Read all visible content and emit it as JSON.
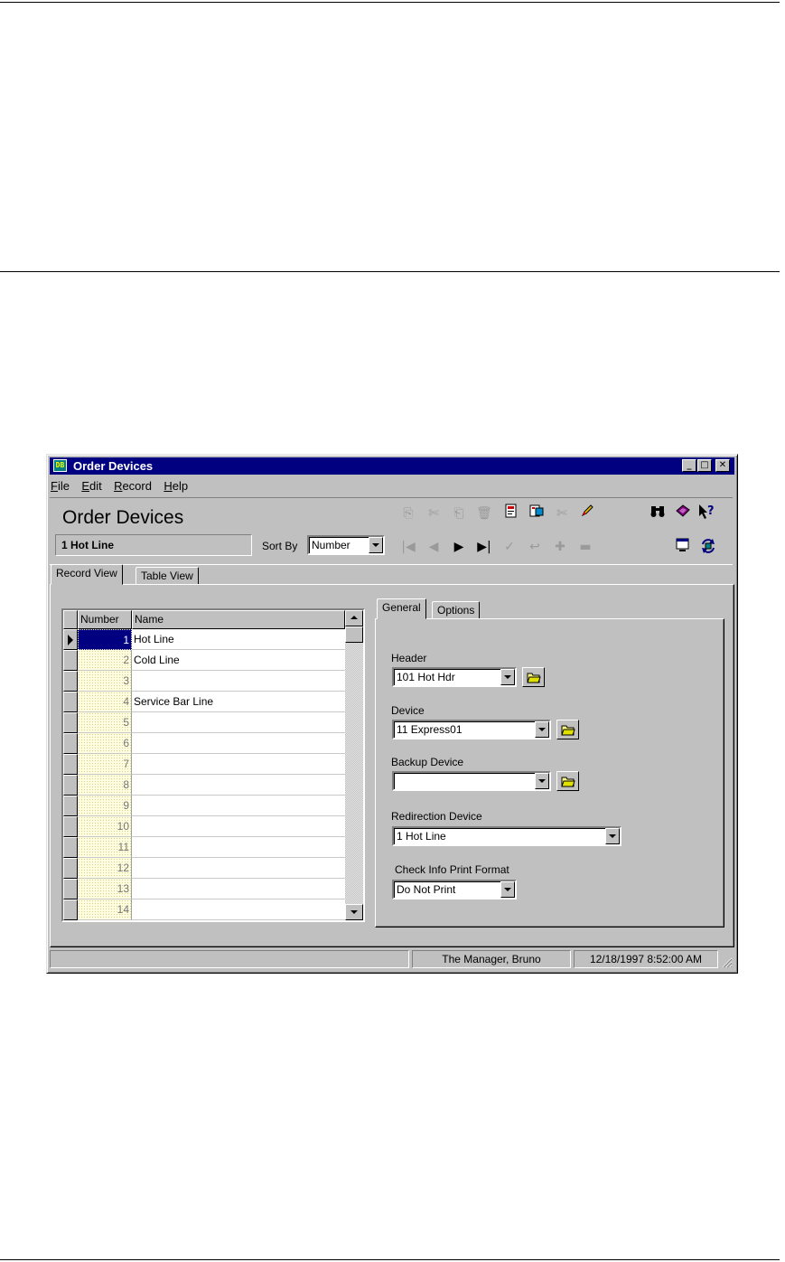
{
  "window": {
    "title": "Order Devices",
    "app_icon_text": "DB",
    "minimize": "_",
    "maximize": "□",
    "close": "✕"
  },
  "menu": [
    {
      "key": "F",
      "rest": "ile"
    },
    {
      "key": "E",
      "rest": "dit"
    },
    {
      "key": "R",
      "rest": "ecord"
    },
    {
      "key": "H",
      "rest": "elp"
    }
  ],
  "header": {
    "title": "Order Devices",
    "current_record": "1  Hot Line",
    "sort_label": "Sort By",
    "sort_value": "Number"
  },
  "tabs": {
    "record_view": "Record View",
    "table_view": "Table View"
  },
  "grid": {
    "columns": [
      "Number",
      "Name"
    ],
    "rows": [
      {
        "number": "1",
        "name": "Hot Line"
      },
      {
        "number": "2",
        "name": "Cold Line"
      },
      {
        "number": "3",
        "name": ""
      },
      {
        "number": "4",
        "name": "Service Bar Line"
      },
      {
        "number": "5",
        "name": ""
      },
      {
        "number": "6",
        "name": ""
      },
      {
        "number": "7",
        "name": ""
      },
      {
        "number": "8",
        "name": ""
      },
      {
        "number": "9",
        "name": ""
      },
      {
        "number": "10",
        "name": ""
      },
      {
        "number": "11",
        "name": ""
      },
      {
        "number": "12",
        "name": ""
      },
      {
        "number": "13",
        "name": ""
      },
      {
        "number": "14",
        "name": ""
      }
    ]
  },
  "detail": {
    "tabs": {
      "general": "General",
      "options": "Options"
    },
    "header_label": "Header",
    "header_value": "101  Hot Hdr",
    "device_label": "Device",
    "device_value": "11  Express01",
    "backup_label": "Backup Device",
    "backup_value": "",
    "redirect_label": "Redirection Device",
    "redirect_value": "1  Hot Line",
    "check_info_label": "Check Info Print Format",
    "check_info_value": "Do Not Print"
  },
  "status": {
    "user": "The Manager, Bruno",
    "datetime": "12/18/1997 8:52:00 AM"
  },
  "colors": {
    "titlebar": "#000080",
    "face": "#c0c0c0",
    "selection": "#000080"
  }
}
